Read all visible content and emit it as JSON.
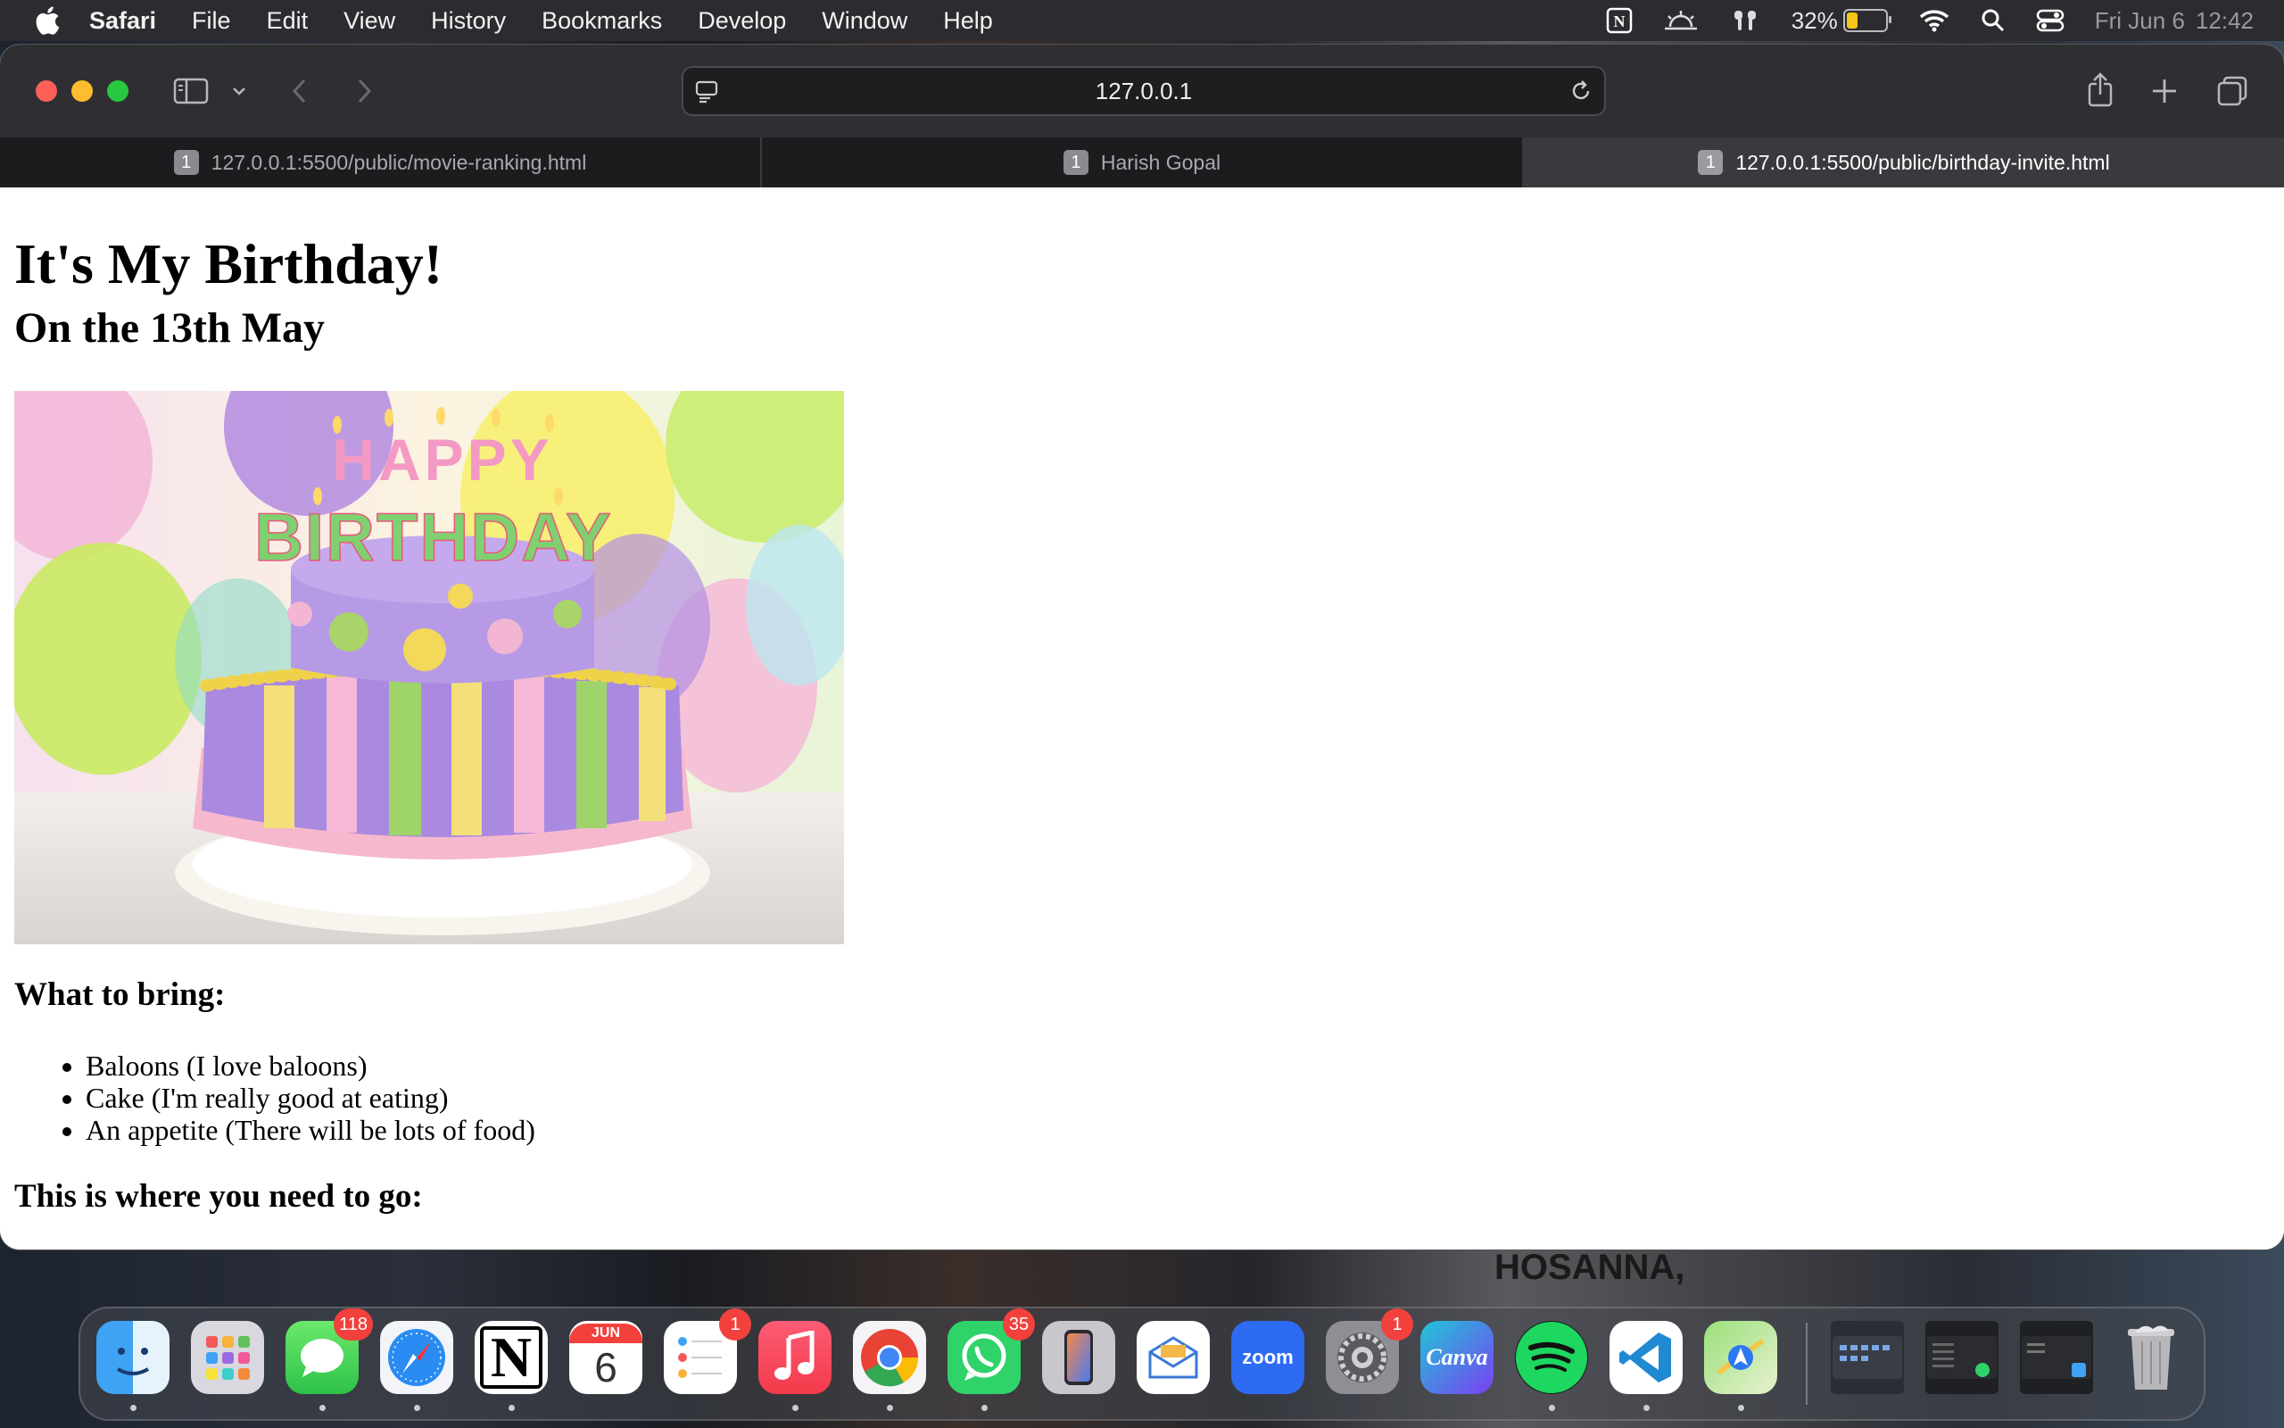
{
  "menubar": {
    "app_name": "Safari",
    "items": [
      "File",
      "Edit",
      "View",
      "History",
      "Bookmarks",
      "Develop",
      "Window",
      "Help"
    ],
    "battery_percent": "32%",
    "battery_level": 0.32,
    "date": "Fri Jun 6",
    "time": "12:42"
  },
  "toolbar": {
    "address": "127.0.0.1"
  },
  "tabs": [
    {
      "count": "1",
      "label": "127.0.0.1:5500/public/movie-ranking.html",
      "active": false
    },
    {
      "count": "1",
      "label": "Harish Gopal",
      "active": false
    },
    {
      "count": "1",
      "label": "127.0.0.1:5500/public/birthday-invite.html",
      "active": true
    }
  ],
  "page": {
    "title": "It's My Birthday!",
    "date_heading": "On the 13th May",
    "bring_heading": "What to bring:",
    "bring_items": [
      "Baloons (I love baloons)",
      "Cake (I'm really good at eating)",
      "An appetite (There will be lots of food)"
    ],
    "cake_text": "HAPPY BIRTHDAY",
    "go_heading": "This is where you need to go:"
  },
  "dock": {
    "apps": [
      {
        "name": "Finder"
      },
      {
        "name": "Launchpad"
      },
      {
        "name": "Messages",
        "badge": "118"
      },
      {
        "name": "Safari"
      },
      {
        "name": "Notion",
        "glyph": "N"
      },
      {
        "name": "Calendar",
        "month": "JUN",
        "day": "6"
      },
      {
        "name": "Reminders",
        "badge": "1"
      },
      {
        "name": "Music"
      },
      {
        "name": "Chrome"
      },
      {
        "name": "WhatsApp",
        "badge": "35"
      },
      {
        "name": "iPhone Mirroring"
      },
      {
        "name": "Mail"
      },
      {
        "name": "Zoom",
        "glyph": "zoom"
      },
      {
        "name": "System Settings",
        "badge": "1"
      },
      {
        "name": "Canva",
        "glyph": "Canva"
      },
      {
        "name": "Spotify"
      },
      {
        "name": "VS Code"
      },
      {
        "name": "Maps"
      },
      {
        "name": "Finder Window"
      },
      {
        "name": "WhatsApp Window"
      },
      {
        "name": "Finder Window 2"
      },
      {
        "name": "Trash"
      }
    ]
  },
  "wallpaper": {
    "text": "HOSANNA,"
  },
  "colors": {
    "menubar_bg": "#2c2c30",
    "toolbar_bg": "#2f2f33",
    "tab_active_bg": "#3a3a3e",
    "badge_red": "#f2413c"
  }
}
